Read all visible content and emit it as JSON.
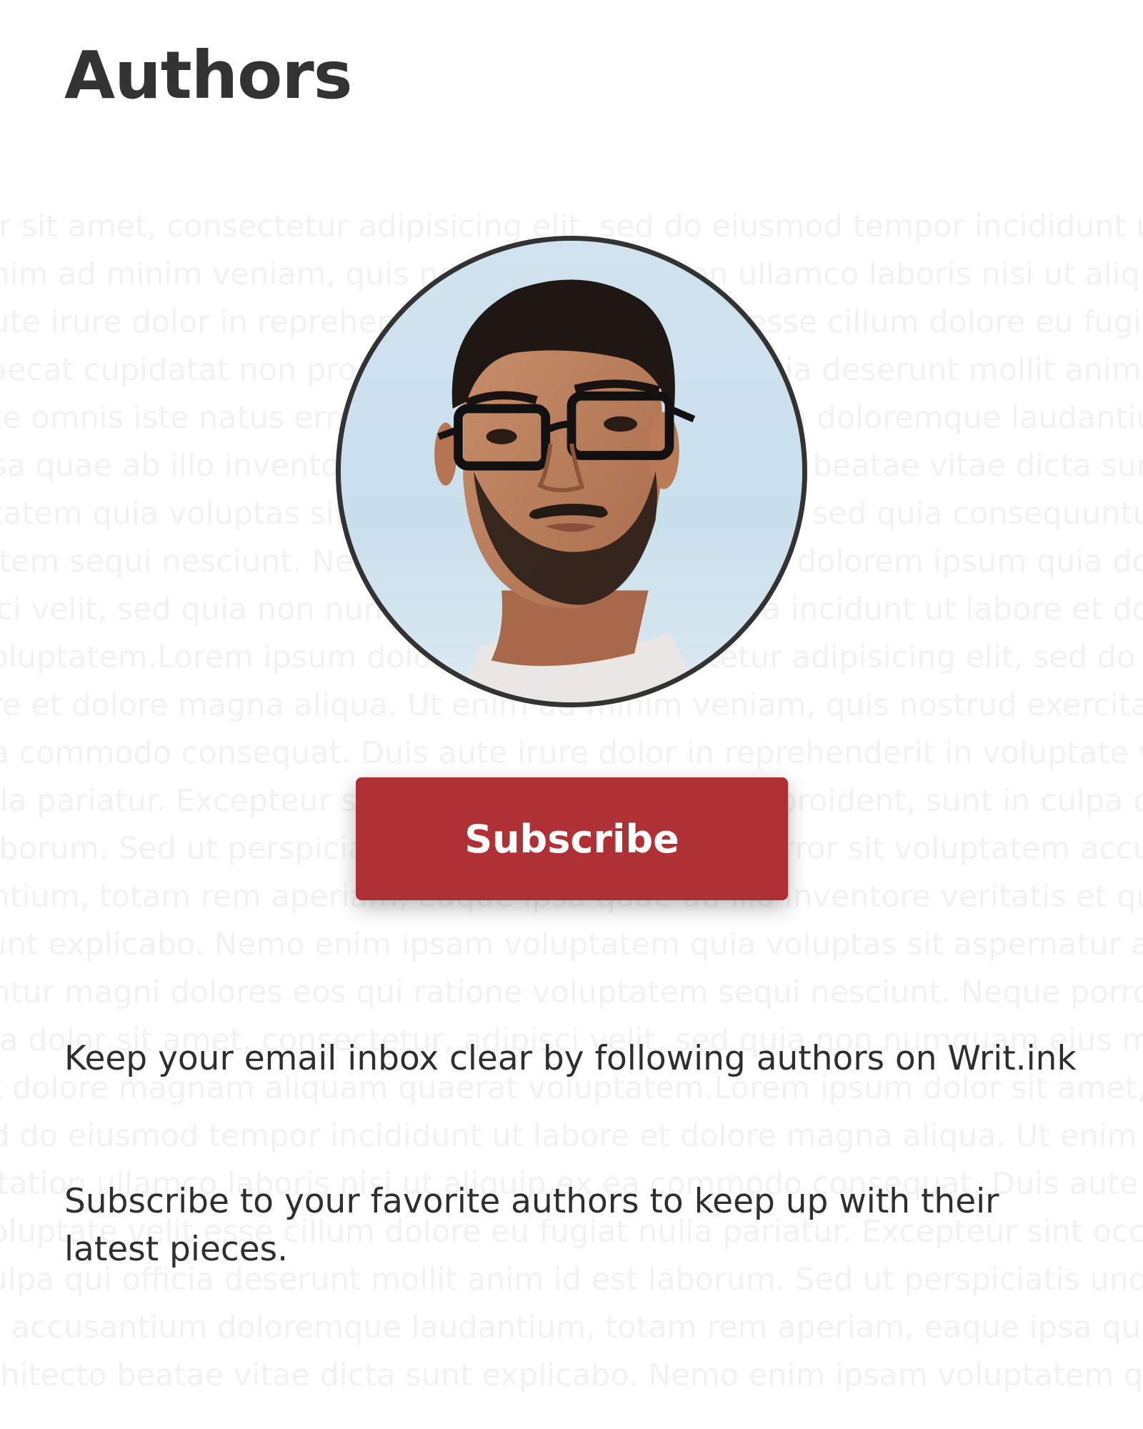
{
  "page": {
    "title": "Authors"
  },
  "background": {
    "lines": [
      "lor sit amet, consectetur adipisicing elit, sed do eiusmod tempor incididunt ut la",
      "enim ad minim veniam, quis nostrud exercitation ullamco laboris nisi ut aliquip",
      "aute irure dolor in reprehenderit in voluptate velit esse cillum dolore eu fugiat n",
      "caecat cupidatat non proident, sunt in culpa qui officia deserunt mollit anim id",
      "ate omnis iste natus error sit voluptatem accusantium doloremque laudantium,",
      "psa quae ab illo inventore veritatis et quasi architecto beatae vitae dicta sunt ex",
      "ptatem quia voluptas sit aspernatur aut odit aut fugit, sed quia consequuntur m",
      "latem sequi nesciunt. Neque porro quisquam est, qui dolorem ipsum quia dolor",
      "isci velit, sed quia non numquam eius modi tempora incidunt ut labore et dolore",
      "voluptatem.Lorem ipsum dolor sit amet, consectetur adipisicing elit, sed do eiu",
      "ore et dolore magna aliqua. Ut enim ad minim veniam, quis nostrud exercitatio",
      "ea commodo consequat. Duis aute irure dolor in reprehenderit in voluptate veli",
      "ulla pariatur. Excepteur sint occaecat cupidatat non proident, sunt in culpa qu",
      "laborum. Sed ut perspiciatis unde omnis iste natus error sit voluptatem accusa",
      "antium, totam rem aperiam, eaque ipsa quae ab illo inventore veritatis et quasi",
      "sunt explicabo. Nemo enim ipsam voluptatem quia voluptas sit aspernatur aut",
      "untur magni dolores eos qui ratione voluptatem sequi nesciunt. Neque porro q",
      "uia dolor sit amet, consectetur, adipisci velit, sed quia non numquam eius mod",
      "et dolore magnam aliquam quaerat voluptatem.Lorem ipsum dolor sit amet,",
      "ed do eiusmod tempor incididunt ut labore et dolore magna aliqua. Ut enim ad",
      "citation ullamco laboris nisi ut aliquip ex ea commodo consequat. Duis aute irur",
      "voluptate velit esse cillum dolore eu fugiat nulla pariatur. Excepteur sint occaec",
      "culpa qui officia deserunt mollit anim id est laborum. Sed ut perspiciatis unde",
      "m accusantium doloremque laudantium, totam rem aperiam, eaque ipsa quae",
      "rchitecto beatae vitae dicta sunt explicabo. Nemo enim ipsam voluptatem qui"
    ]
  },
  "author": {
    "avatar_icon": "author-avatar-photo"
  },
  "actions": {
    "subscribe_label": "Subscribe"
  },
  "copy": {
    "paragraph_1": "Keep your email inbox clear by following authors on Writ.ink",
    "paragraph_2": "Subscribe to your favorite authors to keep up with their latest pieces."
  },
  "colors": {
    "accent": "#b03135",
    "title": "#333333",
    "text": "#2e2e2e",
    "watermark_text": "#f2f2f2"
  }
}
